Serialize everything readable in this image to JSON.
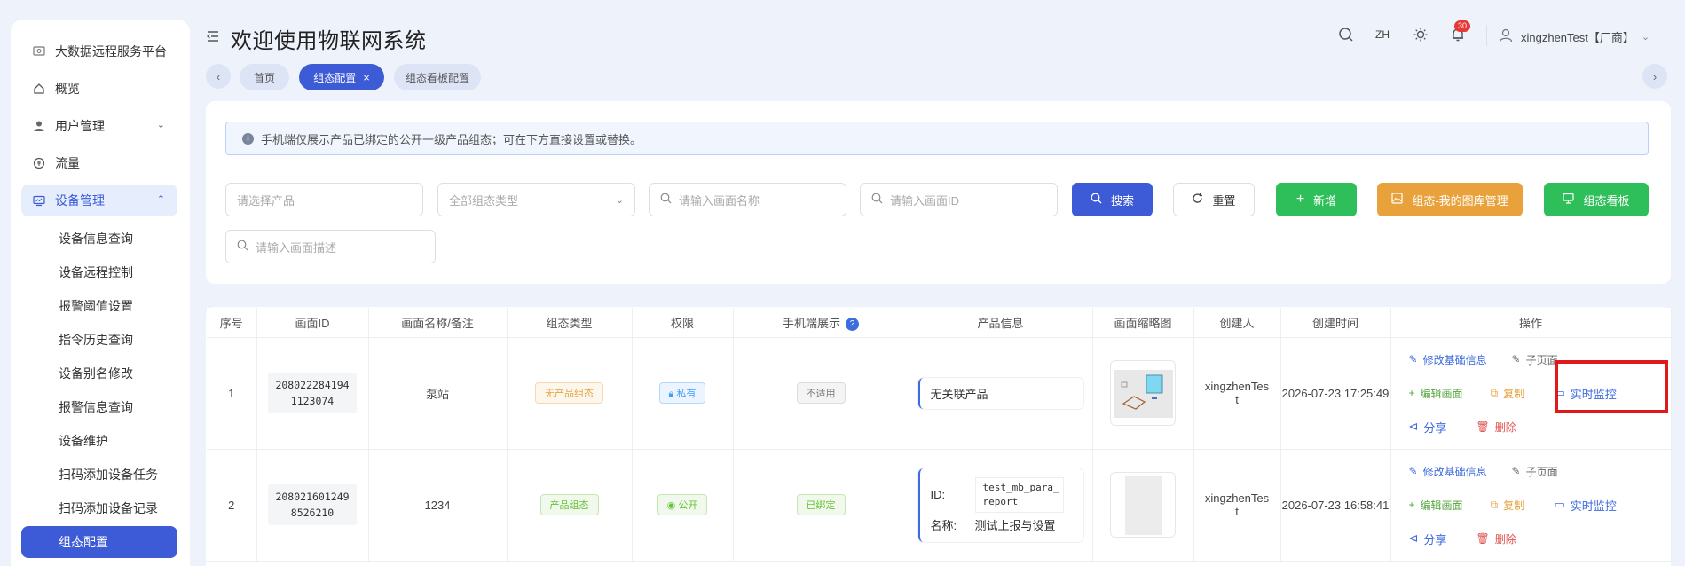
{
  "sidebar": {
    "items": [
      {
        "label": "大数据远程服务平台",
        "icon": "platform-icon"
      },
      {
        "label": "概览",
        "icon": "home-icon"
      },
      {
        "label": "用户管理",
        "icon": "user-icon"
      },
      {
        "label": "流量",
        "icon": "traffic-icon"
      },
      {
        "label": "设备管理",
        "icon": "device-icon"
      }
    ],
    "sub_items": [
      "设备信息查询",
      "设备远程控制",
      "报警阈值设置",
      "指令历史查询",
      "设备别名修改",
      "报警信息查询",
      "设备维护",
      "扫码添加设备任务",
      "扫码添加设备记录"
    ],
    "selected": "组态配置"
  },
  "header": {
    "title": "欢迎使用物联网系统",
    "lang": "ZH",
    "notification_count": "30",
    "user": "xingzhenTest【厂商】"
  },
  "tabs": [
    {
      "label": "首页"
    },
    {
      "label": "组态配置",
      "close": "×"
    },
    {
      "label": "组态看板配置"
    }
  ],
  "notice": "手机端仅展示产品已绑定的公开一级产品组态；可在下方直接设置或替换。",
  "filters": {
    "product_placeholder": "请选择产品",
    "type_placeholder": "全部组态类型",
    "name_placeholder": "请输入画面名称",
    "id_placeholder": "请输入画面ID",
    "desc_placeholder": "请输入画面描述"
  },
  "buttons": {
    "search": "搜索",
    "reset": "重置",
    "add": "新增",
    "library": "组态-我的图库管理",
    "board": "组态看板"
  },
  "table": {
    "headers": [
      "序号",
      "画面ID",
      "画面名称/备注",
      "组态类型",
      "权限",
      "手机端展示",
      "产品信息",
      "画面缩略图",
      "创建人",
      "创建时间",
      "操作"
    ],
    "rows": [
      {
        "index": "1",
        "id_line1": "208022284194",
        "id_line2": "1123074",
        "name": "泵站",
        "type": "无产品组态",
        "permission": "私有",
        "mobile": "不适用",
        "product": "无关联产品",
        "creator_line1": "xingzhenTes",
        "creator_line2": "t",
        "created": "2026-07-23 17:25:49"
      },
      {
        "index": "2",
        "id_line1": "208021601249",
        "id_line2": "8526210",
        "name": "1234",
        "type": "产品组态",
        "permission": "公开",
        "mobile": "已绑定",
        "product_id_label": "ID:",
        "product_id_line1": "test_mb_para_",
        "product_id_line2": "report",
        "product_name_label": "名称:",
        "product_name": "测试上报与设置",
        "creator_line1": "xingzhenTes",
        "creator_line2": "t",
        "created": "2026-07-23 16:58:41"
      }
    ],
    "ops": {
      "edit_info": "修改基础信息",
      "subpage": "子页面",
      "edit_screen": "编辑画面",
      "copy": "复制",
      "monitor": "实时监控",
      "share": "分享",
      "delete": "删除"
    }
  },
  "colors": {
    "primary": "#3d5bd6",
    "success": "#2fbf5a",
    "warning": "#e9a23b",
    "highlight": "#e01a1a"
  }
}
